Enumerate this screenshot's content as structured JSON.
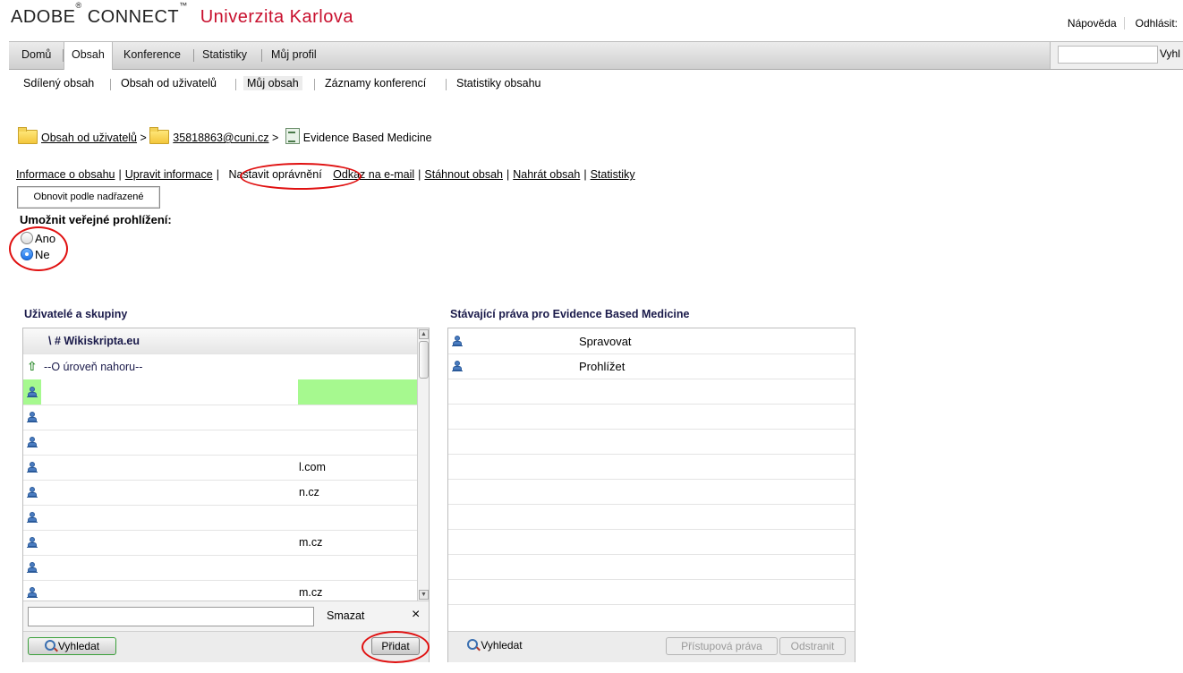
{
  "header": {
    "brand": "ADOBE",
    "brand_reg": "®",
    "brand2": "CONNECT",
    "brand_tm": "™",
    "university": "Univerzita Karlova",
    "help": "Nápověda",
    "logout": "Odhlásit:"
  },
  "nav": {
    "tabs": [
      "Domů",
      "Obsah",
      "Konference",
      "Statistiky",
      "Můj profil"
    ],
    "active": "Obsah",
    "search_value": "",
    "search_button": "Vyhl"
  },
  "subnav": {
    "items": [
      "Sdílený obsah",
      "Obsah od uživatelů",
      "Můj obsah",
      "Záznamy konferencí",
      "Statistiky obsahu"
    ],
    "active": "Můj obsah"
  },
  "breadcrumb": {
    "level1": "Obsah od uživatelů",
    "level2": "35818863@cuni.cz",
    "current": "Evidence Based Medicine",
    "sep": ">"
  },
  "actions": {
    "links": [
      "Informace o obsahu",
      "Upravit informace",
      "Nastavit oprávnění",
      "Odkaz na e-mail",
      "Stáhnout obsah",
      "Nahrát obsah",
      "Statistiky"
    ],
    "current": "Nastavit oprávnění",
    "restore_button": "Obnovit podle nadřazené"
  },
  "public_view": {
    "title": "Umožnit veřejné prohlížení:",
    "options": [
      "Ano",
      "Ne"
    ],
    "selected": "Ne"
  },
  "users_panel": {
    "title": "Uživatelé a skupiny",
    "header": "\\ # Wikiskripta.eu",
    "up_level": "--O úroveň nahoru--",
    "rows": [
      "",
      "",
      "",
      "l.com",
      "n.cz",
      "",
      "m.cz",
      "",
      "m.cz"
    ],
    "filter_value": "",
    "clear_label": "Smazat",
    "close_label": "×",
    "search_button": "Vyhledat",
    "add_button": "Přidat"
  },
  "rights_panel": {
    "title": "Stávající práva pro Evidence Based Medicine",
    "rows": [
      {
        "name": "",
        "permission": "Spravovat"
      },
      {
        "name": "",
        "permission": "Prohlížet"
      }
    ],
    "search_button": "Vyhledat",
    "access_button": "Přístupová práva",
    "remove_button": "Odstranit"
  },
  "colors": {
    "highlight_row": "#a6f98f",
    "annotation_ring": "#e01010",
    "brand_red": "#c8102e"
  }
}
